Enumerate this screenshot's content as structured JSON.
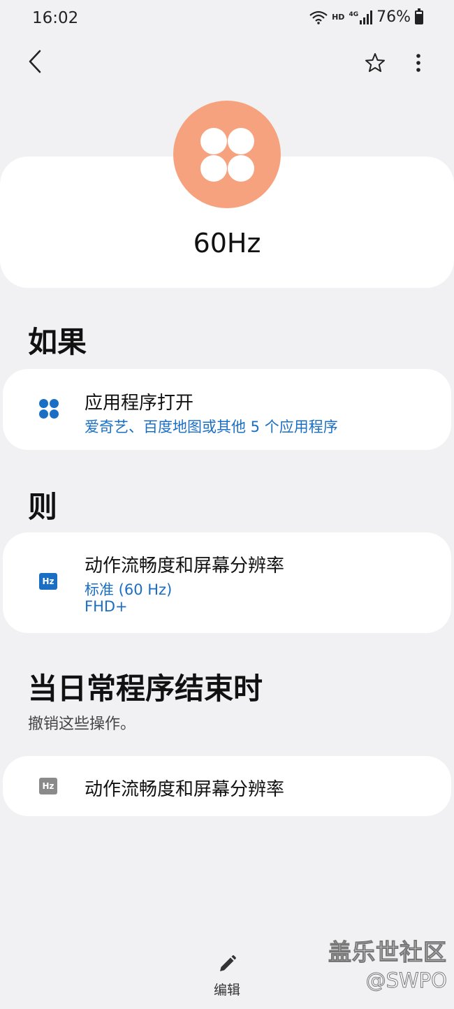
{
  "status_bar": {
    "time": "16:02",
    "network_hd": "HD",
    "network_type": "4G",
    "battery": "76%",
    "battery_level": 0.76
  },
  "app_bar": {
    "back_icon": "chevron-left-icon",
    "favorite_icon": "star-outline-icon",
    "more_icon": "more-vertical-icon"
  },
  "routine": {
    "title": "60Hz",
    "icon": "four-dots-icon",
    "icon_color": "#f7a27e"
  },
  "if_section": {
    "heading": "如果",
    "condition": {
      "title": "应用程序打开",
      "subtitle": "爱奇艺、百度地图或其他 5 个应用程序",
      "icon": "apps-icon",
      "icon_color": "#1a6fc4"
    }
  },
  "then_section": {
    "heading": "则",
    "action": {
      "title": "动作流畅度和屏幕分辨率",
      "line1": "标准 (60 Hz)",
      "line2": "FHD+",
      "icon_label": "Hz",
      "icon_color": "#1a6fc4"
    }
  },
  "end_section": {
    "heading": "当日常程序结束时",
    "description": "撤销这些操作。",
    "action": {
      "title": "动作流畅度和屏幕分辨率",
      "icon_label": "Hz",
      "icon_color": "#8a8a8a"
    }
  },
  "bottom_bar": {
    "edit_label": "编辑",
    "edit_icon": "pencil-icon"
  },
  "watermark": {
    "line1": "盖乐世社区",
    "line2": "@SWPO"
  },
  "colors": {
    "background": "#f1f1f3",
    "card": "#ffffff",
    "accent_blue": "#1a6fc4"
  }
}
